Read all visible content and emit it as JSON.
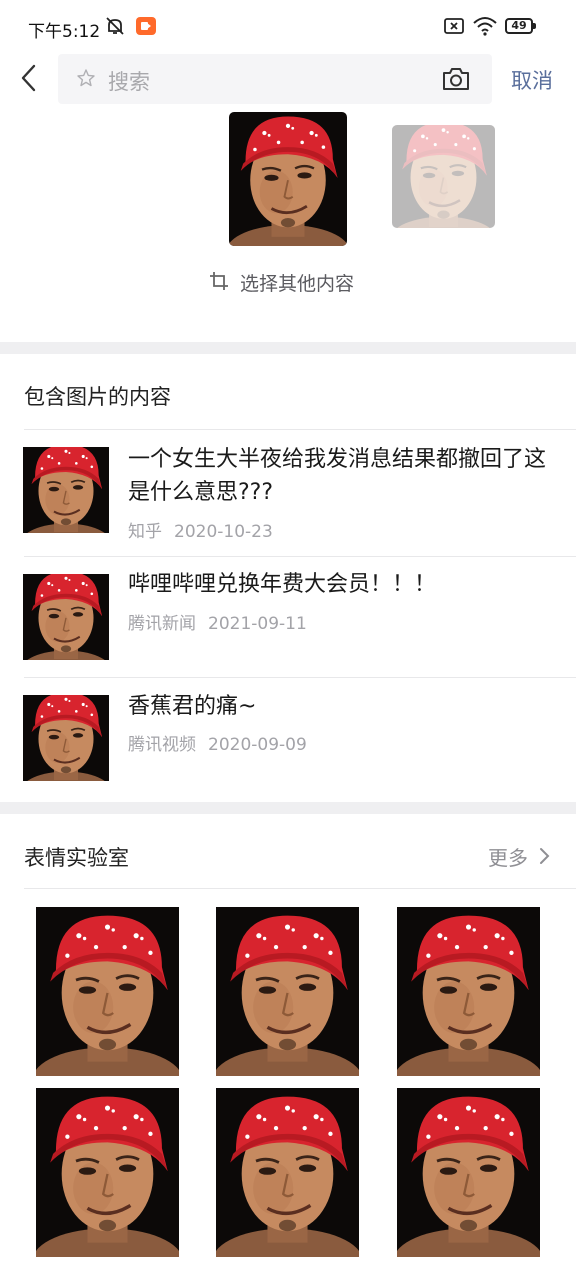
{
  "status_bar": {
    "time": "下午5:12",
    "battery": "49",
    "icons": [
      "notification-muted-icon",
      "screen-record-icon",
      "sim-off-icon",
      "wifi-icon",
      "battery-icon"
    ]
  },
  "search": {
    "placeholder": "搜索",
    "cancel_label": "取消",
    "icons": [
      "back-arrow-icon",
      "star-icon",
      "camera-icon"
    ]
  },
  "image_picker": {
    "select_other_label": "选择其他内容"
  },
  "content_section": {
    "title": "包含图片的内容",
    "items": [
      {
        "title": "一个女生大半夜给我发消息结果都撤回了这是什么意思???",
        "source": "知乎",
        "date": "2020-10-23"
      },
      {
        "title": "哔哩哔哩兑换年费大会员！！！",
        "source": "腾讯新闻",
        "date": "2021-09-11"
      },
      {
        "title": "香蕉君的痛~",
        "source": "腾讯视频",
        "date": "2020-09-09"
      }
    ]
  },
  "emoji_lab": {
    "title": "表情实验室",
    "more_label": "更多"
  },
  "colors": {
    "accent_blue": "#5a6f9c",
    "bandana_red": "#d8242e",
    "section_gap": "#efeff1",
    "meta_gray": "#a3a3a8"
  }
}
